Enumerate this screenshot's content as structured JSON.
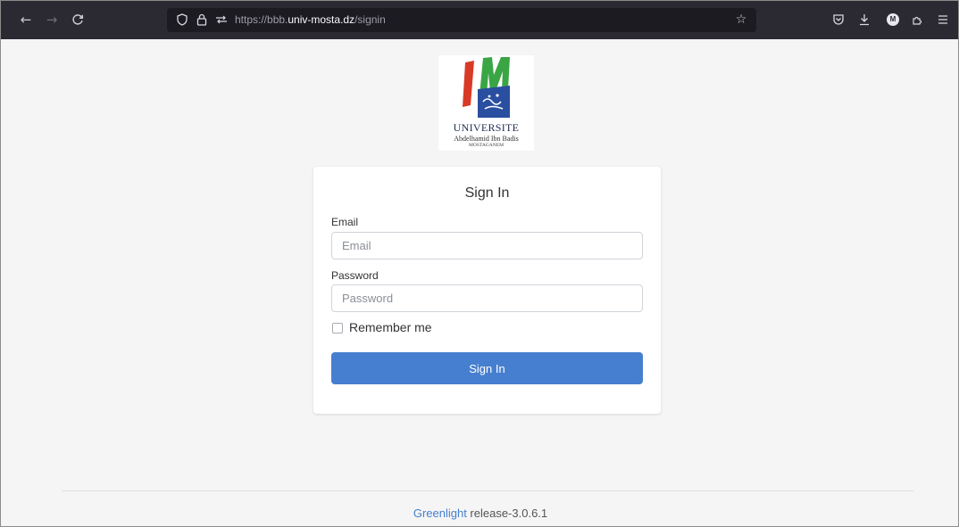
{
  "browser": {
    "back_icon": "←",
    "forward_icon": "→",
    "reload_icon": "C",
    "url_prefix": "https://bbb.",
    "url_domain": "univ-mosta.dz",
    "url_path": "/signin",
    "star_icon": "☆",
    "account_initial": "M",
    "icons": [
      "shield-icon",
      "lock-icon",
      "permissions-icon",
      "bookmark-star-icon",
      "pocket-icon",
      "download-icon",
      "account-icon",
      "extensions-icon",
      "menu-icon"
    ]
  },
  "logo": {
    "line1": "UNIVERSITE",
    "line2": "Abdelhamid Ibn Badis",
    "line3": "MOSTAGANEM",
    "colors": {
      "red": "#d93a26",
      "green": "#3aa545",
      "blue": "#2a4fa0"
    }
  },
  "signin": {
    "title": "Sign In",
    "email_label": "Email",
    "email_placeholder": "Email",
    "email_value": "",
    "password_label": "Password",
    "password_placeholder": "Password",
    "password_value": "",
    "remember_label": "Remember me",
    "remember_checked": false,
    "submit_label": "Sign In",
    "accent_color": "#467fcf"
  },
  "footer": {
    "link_text": "Greenlight",
    "version_text": " release-3.0.6.1"
  }
}
